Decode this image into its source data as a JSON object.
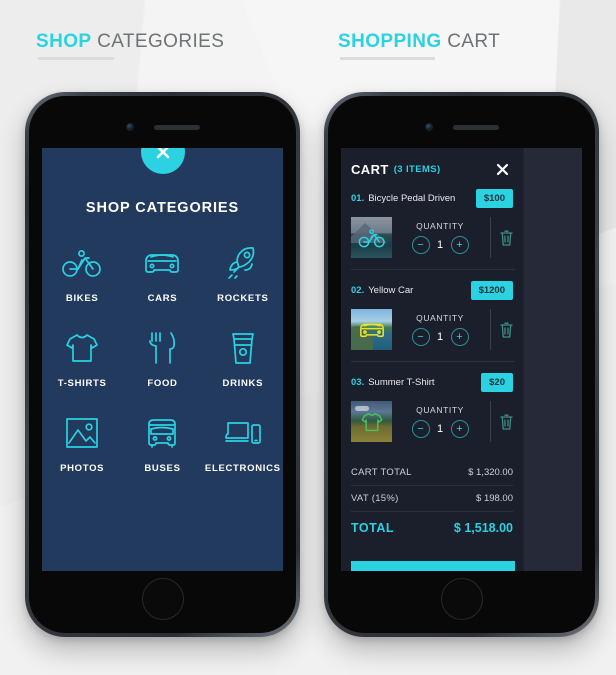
{
  "headings": {
    "shop": {
      "strong": "SHOP",
      "light": "CATEGORIES"
    },
    "cart": {
      "strong": "SHOPPING",
      "light": "CART"
    }
  },
  "categories_screen": {
    "close_icon": "close-icon",
    "title": "SHOP CATEGORIES",
    "items": [
      {
        "label": "BIKES",
        "icon": "bicycle-icon"
      },
      {
        "label": "CARS",
        "icon": "car-icon"
      },
      {
        "label": "ROCKETS",
        "icon": "rocket-icon"
      },
      {
        "label": "T-SHIRTS",
        "icon": "tshirt-icon"
      },
      {
        "label": "FOOD",
        "icon": "fork-knife-icon"
      },
      {
        "label": "DRINKS",
        "icon": "coffee-cup-icon"
      },
      {
        "label": "PHOTOS",
        "icon": "photo-icon"
      },
      {
        "label": "BUSES",
        "icon": "bus-icon"
      },
      {
        "label": "ELECTRONICS",
        "icon": "devices-icon"
      }
    ]
  },
  "cart_screen": {
    "title": "CART",
    "count_label": "(3 ITEMS)",
    "close_icon": "close-icon",
    "quantity_label": "QUANTITY",
    "minus_label": "−",
    "plus_label": "+",
    "items": [
      {
        "index": "01.",
        "name": "Bicycle Pedal Driven",
        "price": "$100",
        "quantity": "1",
        "thumb_icon": "bicycle-icon",
        "thumb_icon_color": "#2ad2e2",
        "delete_icon": "trash-icon"
      },
      {
        "index": "02.",
        "name": "Yellow Car",
        "price": "$1200",
        "quantity": "1",
        "thumb_icon": "car-icon",
        "thumb_icon_color": "#e8e32a",
        "delete_icon": "trash-icon"
      },
      {
        "index": "03.",
        "name": "Summer T-Shirt",
        "price": "$20",
        "quantity": "1",
        "thumb_icon": "tshirt-icon",
        "thumb_icon_color": "#4dbf5e",
        "delete_icon": "trash-icon"
      }
    ],
    "totals": [
      {
        "label": "CART TOTAL",
        "value": "$ 1,320.00"
      },
      {
        "label": "VAT (15%)",
        "value": "$ 198.00"
      }
    ],
    "grand_total": {
      "label": "TOTAL",
      "value": "$ 1,518.00"
    }
  },
  "colors": {
    "accent": "#2ad2e2",
    "categories_bg": "#223a5e",
    "cart_bg": "#1b1e2b",
    "cart_panel": "#262a38",
    "page_bg": "#f1f1f1",
    "heading_light": "#6f7375"
  }
}
